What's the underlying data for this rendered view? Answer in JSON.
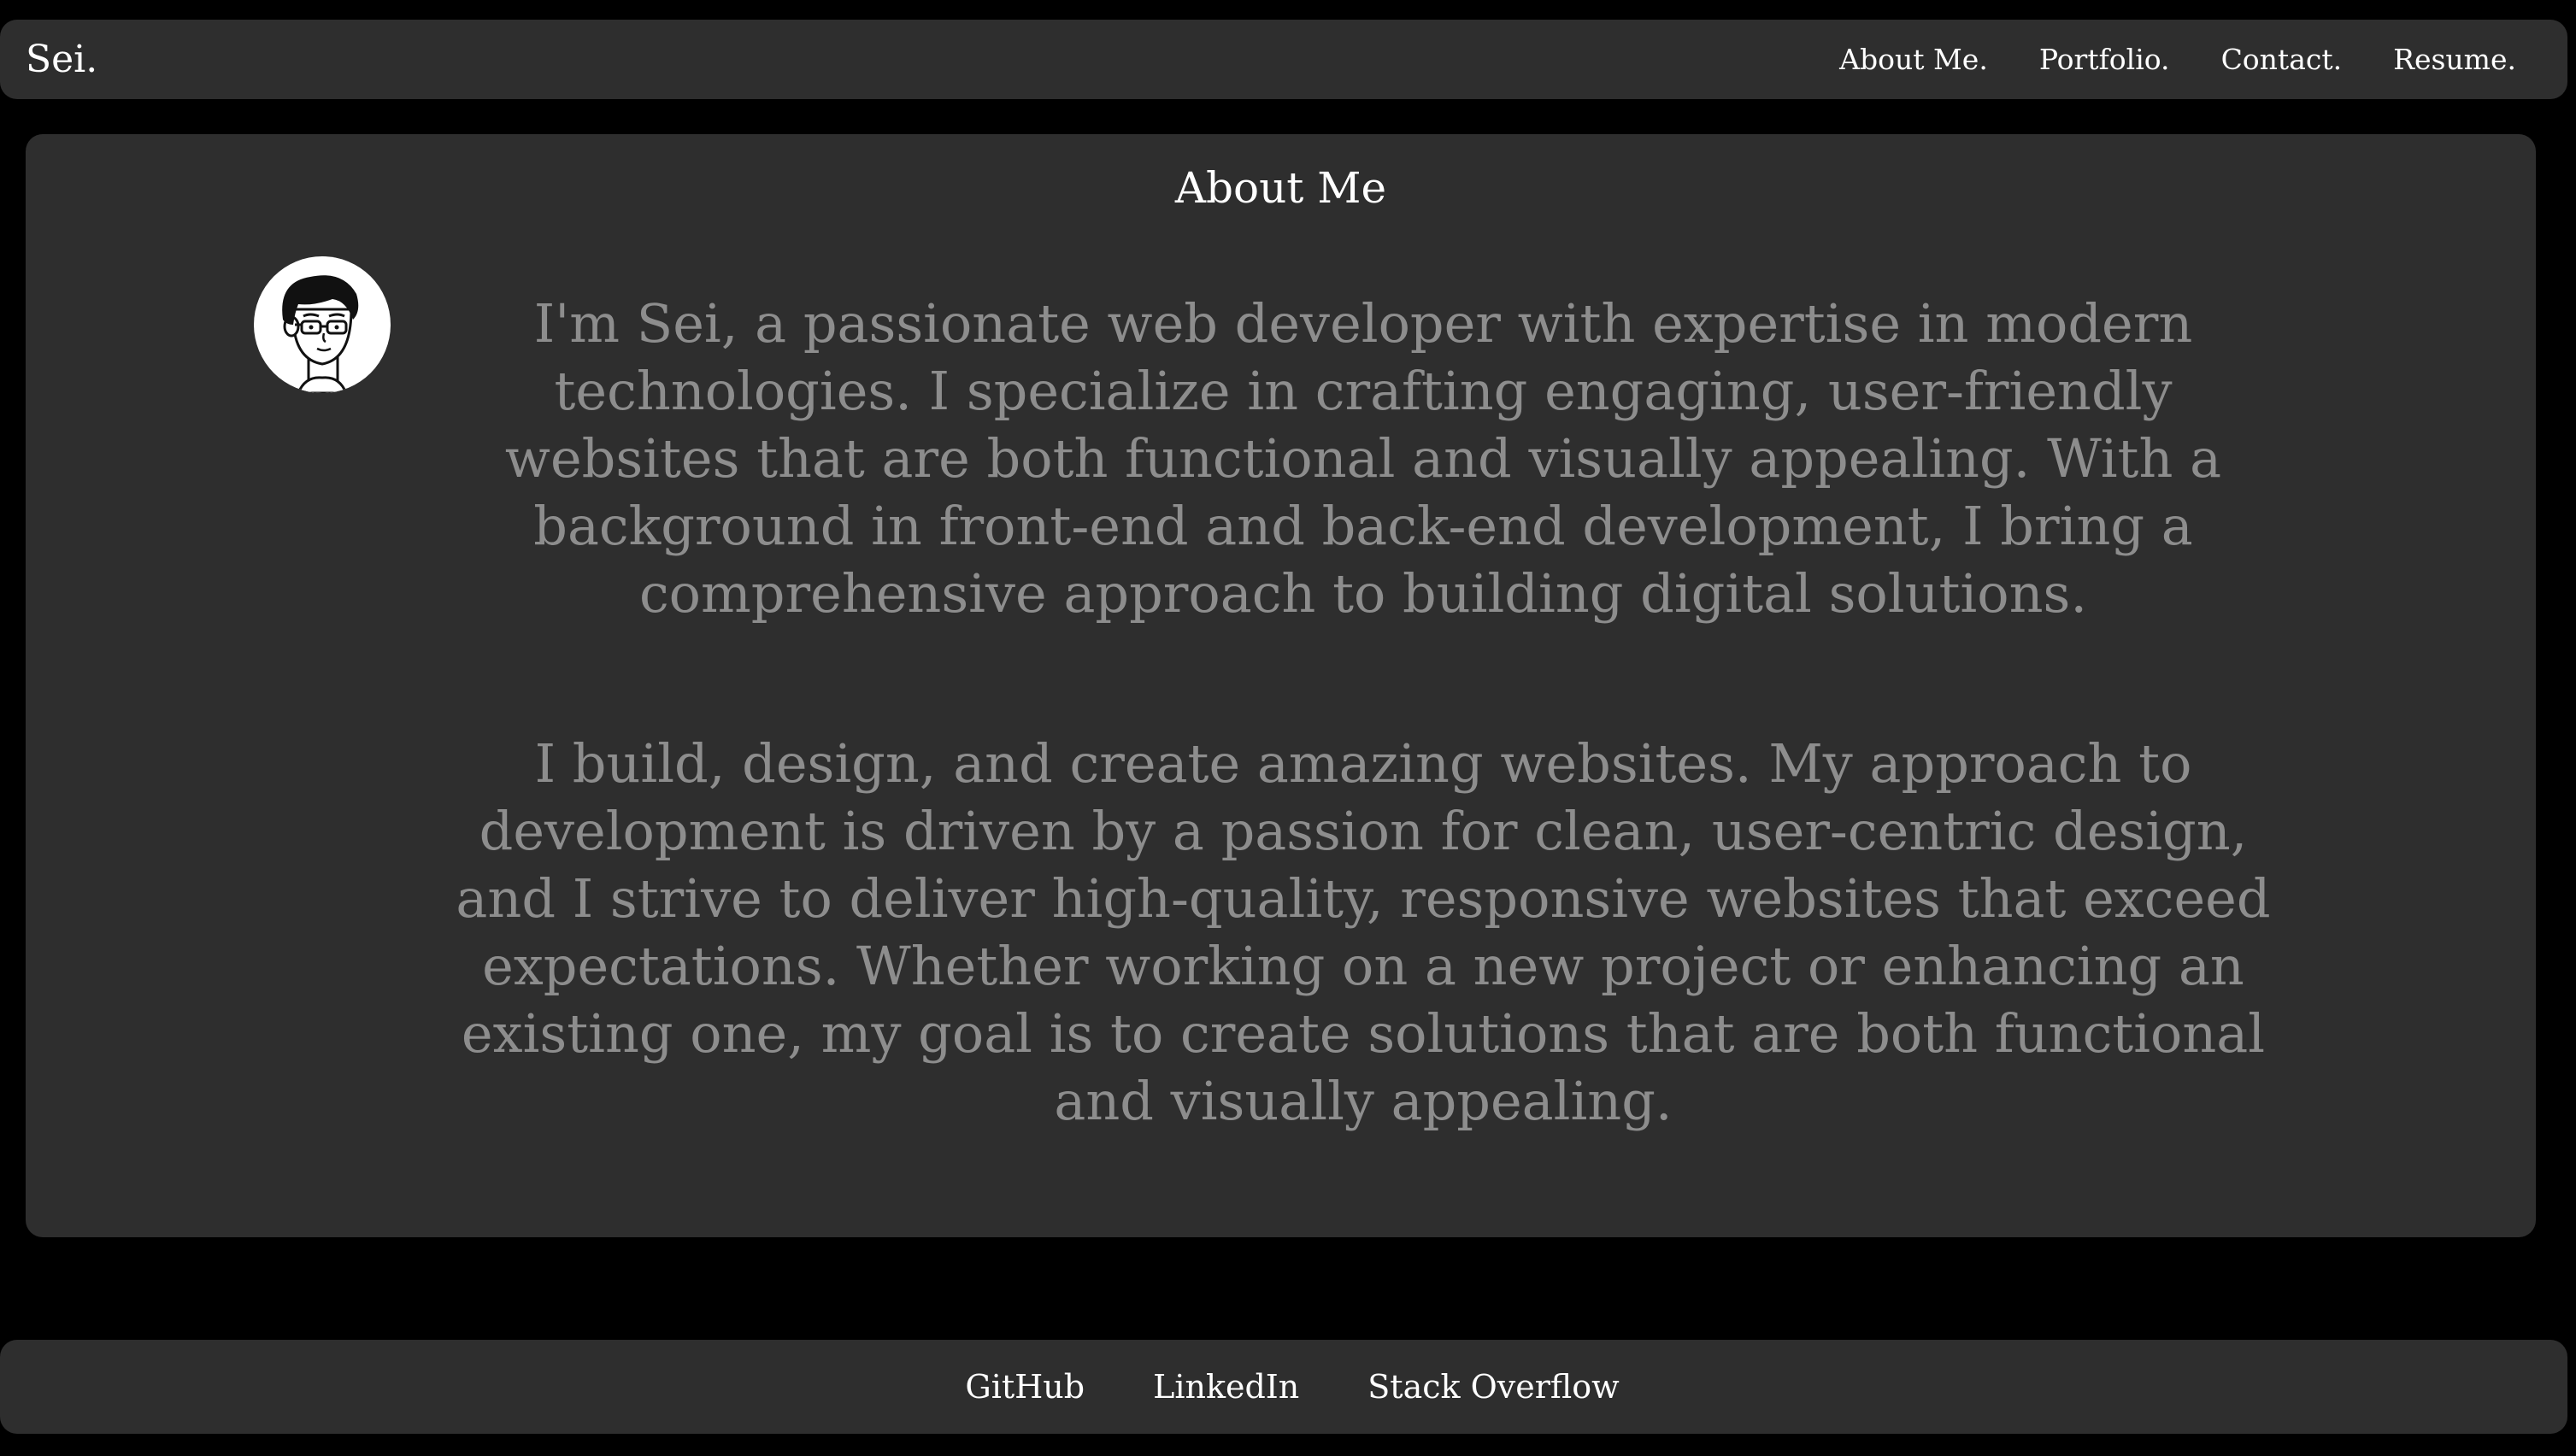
{
  "header": {
    "brand": "Sei.",
    "nav": [
      {
        "label": "About Me."
      },
      {
        "label": "Portfolio."
      },
      {
        "label": "Contact."
      },
      {
        "label": "Resume."
      }
    ]
  },
  "about": {
    "title": "About Me",
    "avatar_icon": "cartoon-avatar-with-glasses",
    "paragraphs": [
      "I'm Sei, a passionate web developer with expertise in modern technologies. I specialize in crafting engaging, user-friendly websites that are both functional and visually appealing. With a background in front-end and back-end development, I bring a comprehensive approach to building digital solutions.",
      "I build, design, and create amazing websites. My approach to development is driven by a passion for clean, user-centric design, and I strive to deliver high-quality, responsive websites that exceed expectations. Whether working on a new project or enhancing an existing one, my goal is to create solutions that are both functional and visually appealing."
    ]
  },
  "footer": {
    "links": [
      {
        "label": "GitHub"
      },
      {
        "label": "LinkedIn"
      },
      {
        "label": "Stack Overflow"
      }
    ]
  },
  "colors": {
    "background": "#000000",
    "surface": "#2e2e2e",
    "text_primary": "#ffffff",
    "text_muted": "#8d8d8d"
  }
}
